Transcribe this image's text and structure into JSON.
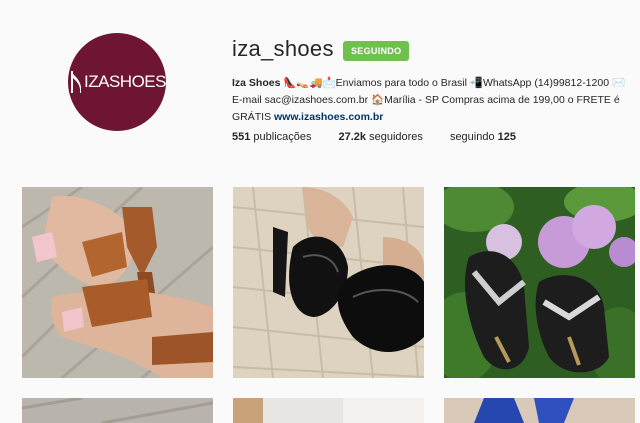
{
  "profile": {
    "username": "iza_shoes",
    "follow_button": "SEGUINDO",
    "avatar_logo_text": "IZASHOES",
    "bio": {
      "name": "Iza Shoes",
      "line": "👠👡🚚📩Enviamos para todo o Brasil 📲WhatsApp (14)99812-1200 ✉️E-mail sac@izashoes.com.br 🏠Marília - SP  Compras acima de 199,00 o FRETE é GRÁTIS",
      "url": "www.izashoes.com.br"
    },
    "stats": {
      "posts_count": "551",
      "posts_label": "publicações",
      "followers_count": "27.2k",
      "followers_label": "seguidores",
      "following_label": "seguindo",
      "following_count": "125"
    }
  },
  "posts": [
    {
      "subject": "brown fringe sandal photo"
    },
    {
      "subject": "black patent pumps photo"
    },
    {
      "subject": "black jeweled thong sandals photo"
    }
  ],
  "colors": {
    "avatar_bg": "#6e1534",
    "following_button": "#70c050",
    "link": "#003569"
  }
}
